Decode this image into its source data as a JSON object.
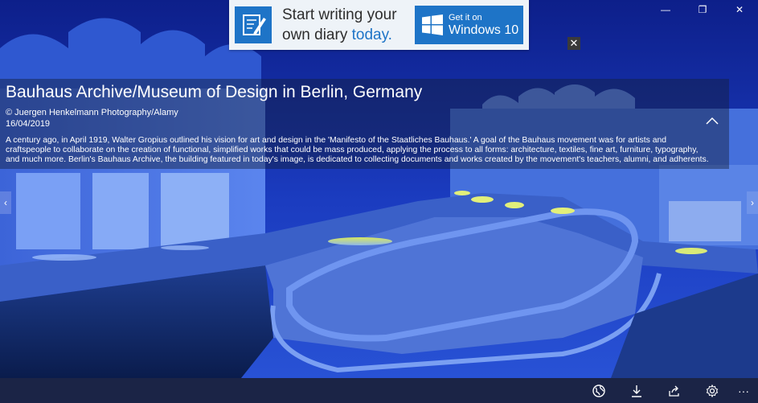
{
  "window": {
    "minimize_glyph": "—",
    "restore_glyph": "❐",
    "close_glyph": "✕"
  },
  "ad": {
    "line1": "Start writing your",
    "line2_prefix": "own diary ",
    "line2_accent": "today.",
    "store_small": "Get it on",
    "store_big": "Windows 10",
    "close_glyph": "✕",
    "accent_color": "#1e74c7",
    "app_icon": "diary-pen-icon",
    "store_icon": "windows-logo-icon"
  },
  "info": {
    "title": "Bauhaus Archive/Museum of Design in Berlin, Germany",
    "credit": "© Juergen Henkelmann Photography/Alamy",
    "date": "16/04/2019",
    "description": "A century ago, in April 1919, Walter Gropius outlined his vision for art and design in the 'Manifesto of the Staatliches Bauhaus.' A goal of the Bauhaus movement was for artists and craftspeople to collaborate on the creation of functional, simplified works that could be mass produced, applying the process to all forms: architecture, textiles, fine art, furniture, typography, and much more. Berlin's Bauhaus Archive, the building featured in today's image, is dedicated to collecting documents and works created by the movement's teachers, alumni, and adherents.",
    "collapse_icon": "chevron-up-icon"
  },
  "nav": {
    "prev_glyph": "‹",
    "next_glyph": "›"
  },
  "toolbar": {
    "buttons": [
      "globe-icon",
      "download-icon",
      "share-icon",
      "settings-icon",
      "more-icon"
    ],
    "more_glyph": "···"
  }
}
